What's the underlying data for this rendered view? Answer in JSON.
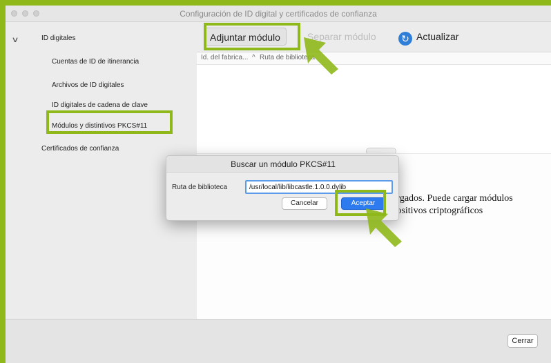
{
  "window": {
    "title": "Configuración de ID digital y certificados de confianza"
  },
  "sidebar": {
    "expand_icon": "chevron-down-icon",
    "root_label": "ID digitales",
    "children": [
      "Cuentas de ID de itinerancia",
      "Archivos de ID digitales",
      "ID digitales de cadena de clave",
      "Módulos y distintivos PKCS#11"
    ],
    "trusted_label": "Certificados de confianza"
  },
  "toolbar": {
    "attach_label": "Adjuntar módulo",
    "detach_label": "Separar módulo",
    "refresh_label": "Actualizar",
    "refresh_icon": "refresh-icon"
  },
  "table": {
    "col_manufacturer": "Id. del fabrica...",
    "col_path": "Ruta de biblioteca"
  },
  "info": {
    "line1": "cargados. Puede cargar módulos",
    "line2": "spositivos criptográficos"
  },
  "dialog": {
    "title": "Buscar un módulo PKCS#11",
    "path_label": "Ruta de biblioteca",
    "path_value": "/usr/local/lib/libcastle.1.0.0.dylib",
    "cancel_label": "Cancelar",
    "accept_label": "Aceptar"
  },
  "footer": {
    "close_label": "Cerrar"
  },
  "annotations": {
    "highlight_color": "#8fb81b",
    "arrow_color": "#8fb81b"
  }
}
